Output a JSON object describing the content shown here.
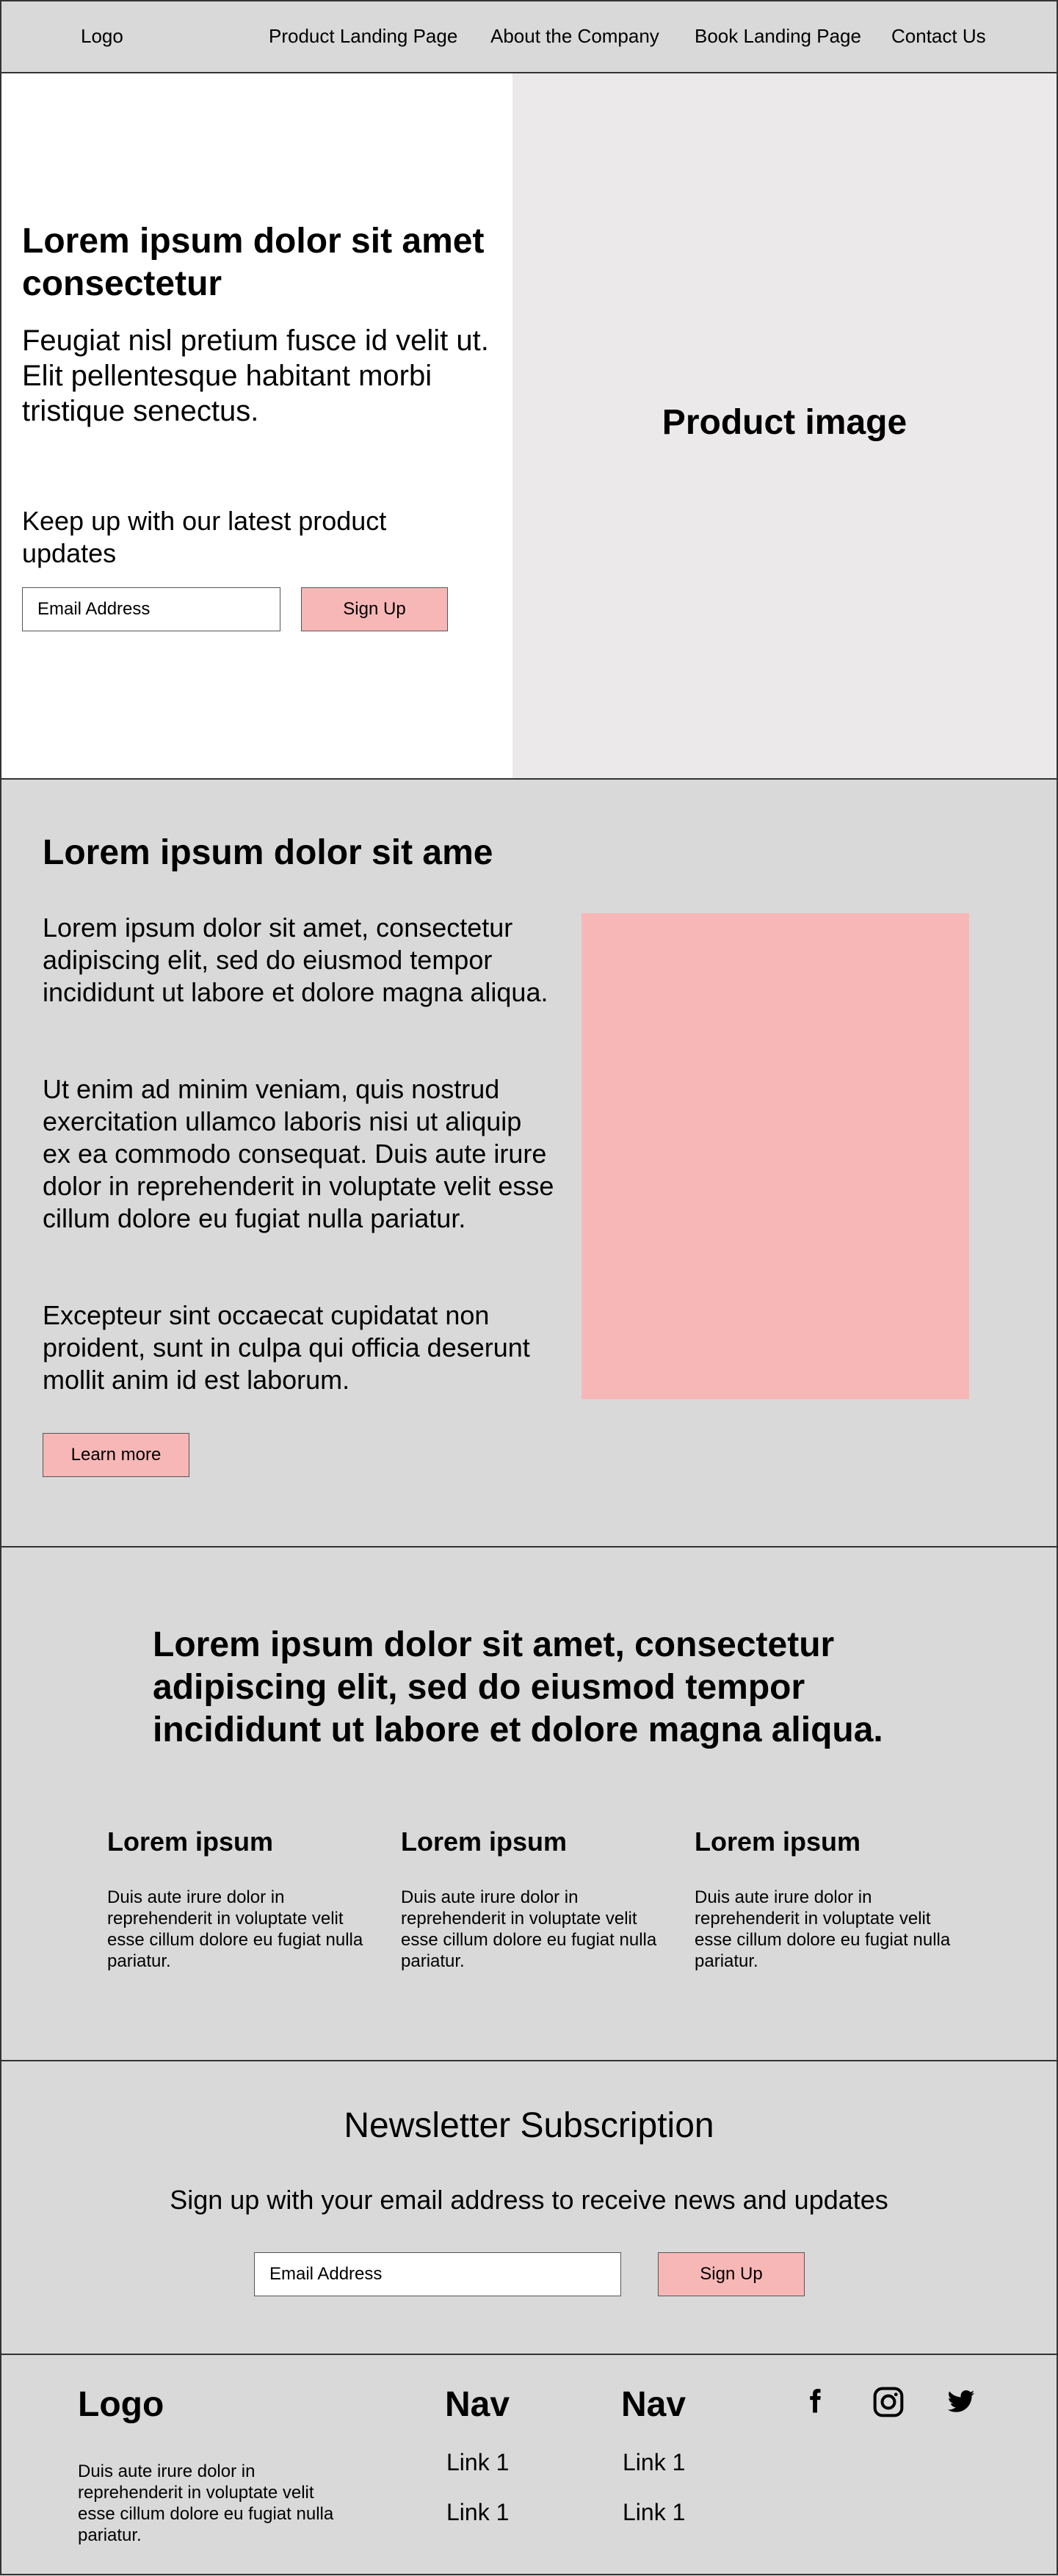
{
  "header": {
    "logo": "Logo",
    "nav": [
      "Product Landing Page",
      "About the Company",
      "Book Landing Page",
      "Contact Us"
    ]
  },
  "hero": {
    "title": "Lorem ipsum dolor sit amet consectetur",
    "subtitle": "Feugiat nisl pretium fusce id velit ut. Elit pellentesque habitant morbi tristique senectus.",
    "updates_text": "Keep up with our latest product updates",
    "email_placeholder": "Email Address",
    "signup_label": "Sign Up",
    "image_label": "Product image"
  },
  "about": {
    "title": "Lorem ipsum dolor sit ame",
    "paragraphs": [
      "Lorem ipsum dolor sit amet, consectetur adipiscing elit, sed do eiusmod tempor incididunt ut labore et dolore magna aliqua.",
      "Ut enim ad minim veniam, quis nostrud exercitation ullamco laboris nisi ut aliquip ex ea commodo consequat. Duis aute irure dolor in reprehenderit in voluptate velit esse cillum dolore eu fugiat nulla pariatur.",
      "Excepteur sint occaecat cupidatat non proident, sunt in culpa qui officia deserunt mollit anim id est laborum."
    ],
    "button_label": "Learn more"
  },
  "features": {
    "title": "Lorem ipsum dolor sit amet, consectetur adipiscing elit, sed do eiusmod tempor incididunt ut labore et dolore magna aliqua.",
    "items": [
      {
        "heading": "Lorem ipsum",
        "text": "Duis aute irure dolor in reprehenderit in voluptate velit esse cillum dolore eu fugiat nulla pariatur."
      },
      {
        "heading": "Lorem ipsum",
        "text": "Duis aute irure dolor in reprehenderit in voluptate velit esse cillum dolore eu fugiat nulla pariatur."
      },
      {
        "heading": "Lorem ipsum",
        "text": "Duis aute irure dolor in reprehenderit in voluptate velit esse cillum dolore eu fugiat nulla pariatur."
      }
    ]
  },
  "newsletter": {
    "title": "Newsletter Subscription",
    "subtitle": "Sign up with your email address to receive news and updates",
    "email_placeholder": "Email Address",
    "signup_label": "Sign Up"
  },
  "footer": {
    "logo": "Logo",
    "text": "Duis aute irure dolor in reprehenderit in voluptate velit esse cillum dolore eu fugiat nulla pariatur.",
    "columns": [
      {
        "heading": "Nav",
        "links": [
          "Link 1",
          "Link 1"
        ]
      },
      {
        "heading": "Nav",
        "links": [
          "Link 1",
          "Link 1"
        ]
      }
    ],
    "social": [
      "facebook-icon",
      "instagram-icon",
      "twitter-icon"
    ]
  },
  "colors": {
    "accent": "#f8b7b7",
    "background": "#d9d9d9",
    "image_panel": "#ebe9ea"
  }
}
